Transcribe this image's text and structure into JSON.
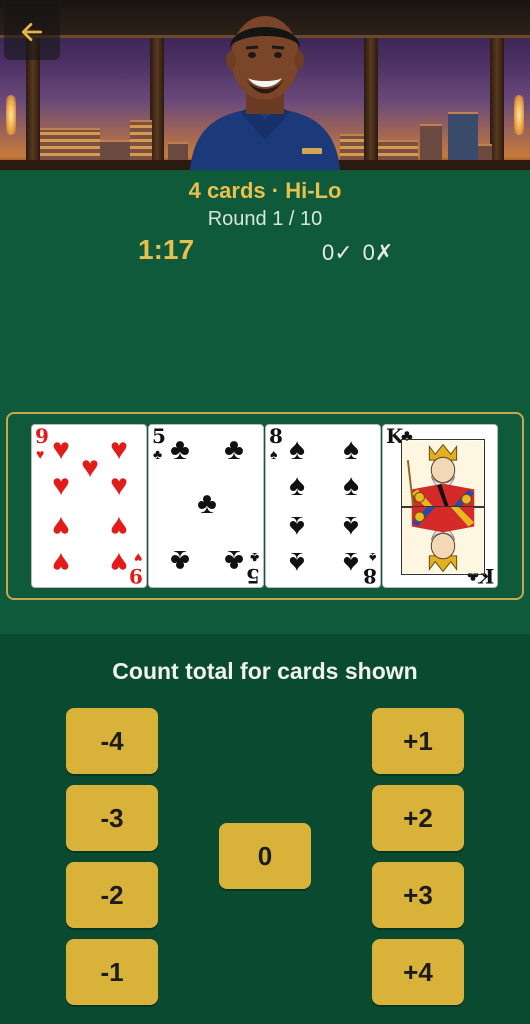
{
  "header": {
    "back_icon": "arrow-left-icon",
    "accent": "#e8c050"
  },
  "info": {
    "mode_title": "4 cards · Hi-Lo",
    "round_label": "Round 1 / 10",
    "timer": "1:17",
    "correct_count": "0✓",
    "wrong_count": "0✗"
  },
  "cards": [
    {
      "rank": "9",
      "suit": "♥",
      "color": "#e21b1b"
    },
    {
      "rank": "5",
      "suit": "♣",
      "color": "#111111"
    },
    {
      "rank": "8",
      "suit": "♠",
      "color": "#111111"
    },
    {
      "rank": "K",
      "suit": "♣",
      "color": "#111111"
    }
  ],
  "answers": {
    "prompt": "Count total for cards shown",
    "left": [
      "-4",
      "-3",
      "-2",
      "-1"
    ],
    "center": "0",
    "right": [
      "+1",
      "+2",
      "+3",
      "+4"
    ],
    "button_color": "#d9b23a"
  }
}
